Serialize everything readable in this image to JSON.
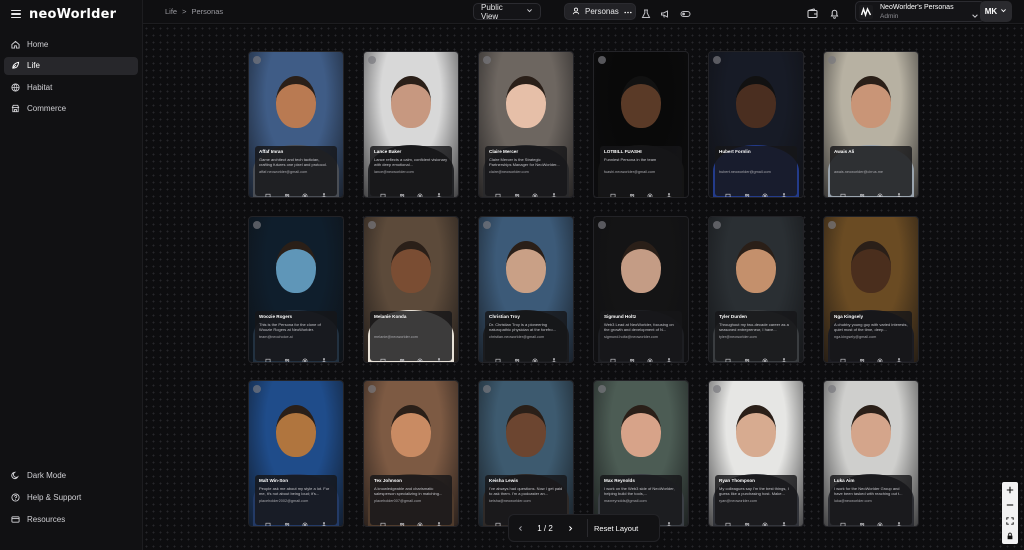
{
  "brand": {
    "name": "neoWorlder"
  },
  "sidebar": {
    "items": [
      {
        "label": "Home",
        "icon": "home-icon",
        "active": false
      },
      {
        "label": "Life",
        "icon": "life-icon",
        "active": true
      },
      {
        "label": "Habitat",
        "icon": "globe-icon",
        "active": false
      },
      {
        "label": "Commerce",
        "icon": "store-icon",
        "active": false
      }
    ],
    "bottom": [
      {
        "label": "Dark Mode",
        "icon": "moon-icon"
      },
      {
        "label": "Help & Support",
        "icon": "help-icon"
      },
      {
        "label": "Resources",
        "icon": "resources-icon"
      }
    ]
  },
  "breadcrumb": {
    "parent": "Life",
    "separator": ">",
    "current": "Personas"
  },
  "toolbar": {
    "view_label": "Public View",
    "personas_label": "Personas"
  },
  "account": {
    "name": "NeoWorlder's Personas",
    "role": "Admin",
    "initials": "MK"
  },
  "pager": {
    "page": "1 / 2",
    "reset_label": "Reset Layout"
  },
  "personas": [
    {
      "name": "Affaf Imran",
      "desc": "Game architect and tech tactician, crafting futures one pixel and protocol.",
      "email": "affaf.neoworlder@gmail.com",
      "bg": "#3f5c86",
      "skin": "#b97a52",
      "shirt": "#4a4e55"
    },
    {
      "name": "Lance Baker",
      "desc": "Lance reflects a calm, confident visionary with deep emotional...",
      "email": "lance@neoworlder.com",
      "bg": "#d8d8d8",
      "skin": "#c79880",
      "shirt": "#222326"
    },
    {
      "name": "Claire Mercer",
      "desc": "Claire Mercer is the Strategic Partnerships Manager for NeoWorlder...",
      "email": "claire@neoworlder.com",
      "bg": "#6d6660",
      "skin": "#e6bfa8",
      "shirt": "#2a2a2c"
    },
    {
      "name": "LOTBILL FUASHI",
      "desc": "Funniest Persona in the team",
      "email": "fuashi.neoworlder@gmail.com",
      "bg": "#090909",
      "skin": "#5a3a27",
      "shirt": "#151515"
    },
    {
      "name": "Hubert Fornlin",
      "desc": "",
      "email": "hubert.neoworlder@gmail.com",
      "bg": "#171b26",
      "skin": "#4a2e20",
      "shirt": "#233b8a"
    },
    {
      "name": "Awais Ali",
      "desc": "",
      "email": "awais.neoworlder@cirrus.me",
      "bg": "#b7b1a2",
      "skin": "#c99577",
      "shirt": "#9aa4ae"
    },
    {
      "name": "Woozie Rogers",
      "desc": "This is the Persona for the clone of Woozie Rogers at NeoWorlder.",
      "email": "team@neochoice.ai",
      "bg": "#0f1e2c",
      "skin": "#5f96b8",
      "shirt": "#223140"
    },
    {
      "name": "Melanie Konda",
      "desc": "",
      "email": "melanie@neoworlder.com",
      "bg": "#5c4a3a",
      "skin": "#7a4d33",
      "shirt": "#e8e2d8"
    },
    {
      "name": "Christian Troy",
      "desc": "Dr. Christian Troy is a pioneering naturopathic physician at the forefro...",
      "email": "christian.neoworlder@gmail.com",
      "bg": "#3c5a78",
      "skin": "#c9a086",
      "shirt": "#1b1c1f"
    },
    {
      "name": "Sigmund Holtz",
      "desc": "Web3 Lead at NeoWorlder, focusing on the growth and development of N...",
      "email": "sigmund.holtz@neoworlder.com",
      "bg": "#141415",
      "skin": "#c49c85",
      "shirt": "#1d1e22"
    },
    {
      "name": "Tyler Durden",
      "desc": "Throughout my two-decade career as a seasoned entrepreneur, I have...",
      "email": "tyler@neoworlder.com",
      "bg": "#2a2f33",
      "skin": "#c4906c",
      "shirt": "#3a3d40"
    },
    {
      "name": "Nga Kingsely",
      "desc": "A chubby young guy with varied interests, quiet most of the time, deep...",
      "email": "nga.kingsely@gmail.com",
      "bg": "#6a4b23",
      "skin": "#4a2e1d",
      "shirt": "#1c1c22"
    },
    {
      "name": "Malt Win-Son",
      "desc": "People ask me about my style a lot. For me, it's not about being loud; it's...",
      "email": "placeholder2002@gmail.com",
      "bg": "#1f4c8a",
      "skin": "#b0753e",
      "shirt": "#233a66"
    },
    {
      "name": "Tex Johnson",
      "desc": "A knowledgeable and charismatic salesperson specializing in matching...",
      "email": "placeholder007@gmail.com",
      "bg": "#7d5a43",
      "skin": "#c98b63",
      "shirt": "#4f3b2c"
    },
    {
      "name": "Keisha Lewis",
      "desc": "I've always had questions. Now I get paid to ask them. I'm a podcaster an...",
      "email": "keisha@neoworlder.com",
      "bg": "#3d5a6f",
      "skin": "#6c4530",
      "shirt": "#2f2a28"
    },
    {
      "name": "Max Reynolds",
      "desc": "I work on the Web3 side of NeoWorlder, helping build the tools,...",
      "email": "maxreynolds@gmail.com",
      "bg": "#4c5c54",
      "skin": "#d7a389",
      "shirt": "#3b3f45"
    },
    {
      "name": "Ryan Thompson",
      "desc": "My colleagues say I'm the best things, I guess like a purchasing host. Make...",
      "email": "ryan@neoworlder.com",
      "bg": "#e6e6e4",
      "skin": "#d7ab90",
      "shirt": "#32343a"
    },
    {
      "name": "Luka Aim",
      "desc": "I work for the NeoWorlder Group and have been tasked with reaching out t...",
      "email": "luka@neoworlder.com",
      "bg": "#cfcfcd",
      "skin": "#d4a58b",
      "shirt": "#2d2e33"
    }
  ]
}
